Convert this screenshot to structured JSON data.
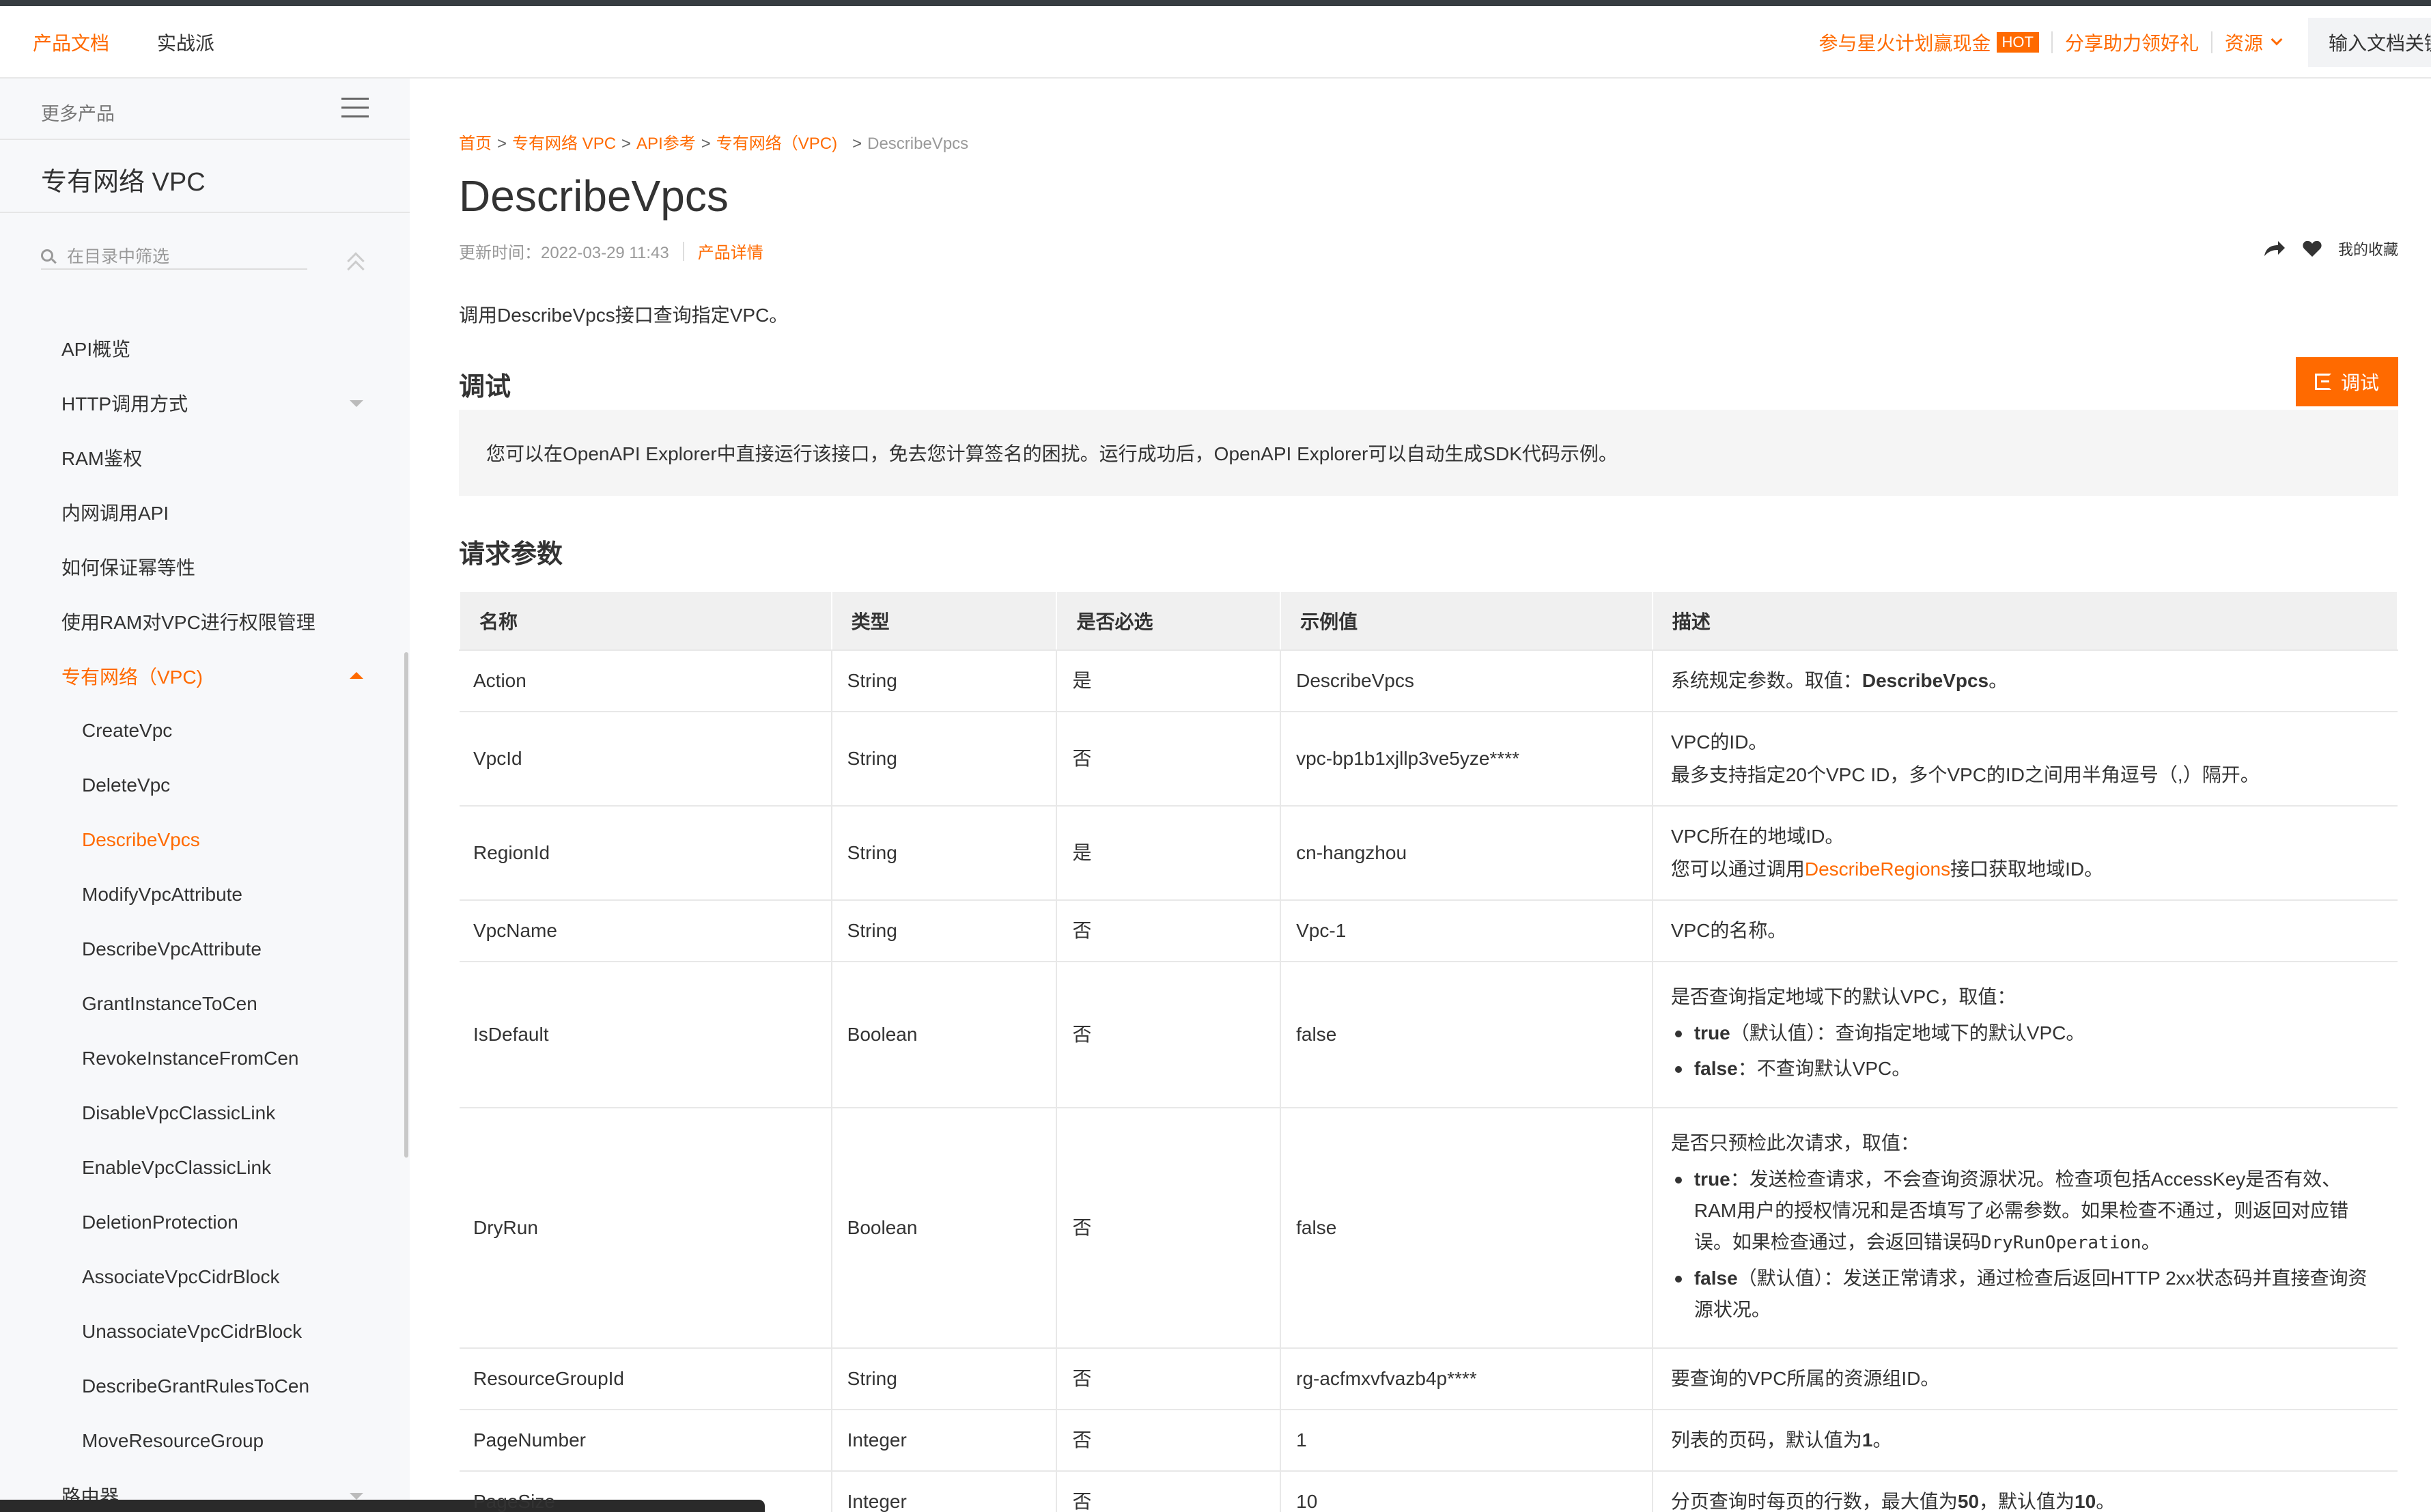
{
  "header": {
    "tabs": [
      "产品文档",
      "实战派"
    ],
    "promo": "参与星火计划赢现金",
    "hot_badge": "HOT",
    "share_gift": "分享助力领好礼",
    "resources": "资源",
    "search_placeholder": "输入文档关键"
  },
  "sidebar": {
    "more_products": "更多产品",
    "product_name": "专有网络 VPC",
    "filter_placeholder": "在目录中筛选",
    "items": [
      {
        "label": "API概览"
      },
      {
        "label": "HTTP调用方式"
      },
      {
        "label": "RAM鉴权"
      },
      {
        "label": "内网调用API"
      },
      {
        "label": "如何保证幂等性"
      },
      {
        "label": "使用RAM对VPC进行权限管理"
      },
      {
        "label": "专有网络（VPC)"
      },
      {
        "label": "CreateVpc"
      },
      {
        "label": "DeleteVpc"
      },
      {
        "label": "DescribeVpcs"
      },
      {
        "label": "ModifyVpcAttribute"
      },
      {
        "label": "DescribeVpcAttribute"
      },
      {
        "label": "GrantInstanceToCen"
      },
      {
        "label": "RevokeInstanceFromCen"
      },
      {
        "label": "DisableVpcClassicLink"
      },
      {
        "label": "EnableVpcClassicLink"
      },
      {
        "label": "DeletionProtection"
      },
      {
        "label": "AssociateVpcCidrBlock"
      },
      {
        "label": "UnassociateVpcCidrBlock"
      },
      {
        "label": "DescribeGrantRulesToCen"
      },
      {
        "label": "MoveResourceGroup"
      },
      {
        "label": "路由器"
      }
    ]
  },
  "breadcrumb": {
    "items": [
      "首页",
      "专有网络 VPC",
      "API参考",
      "专有网络（VPC)"
    ],
    "current": "DescribeVpcs"
  },
  "page": {
    "title": "DescribeVpcs",
    "updated": "更新时间：2022-03-29 11:43",
    "product_detail": "产品详情",
    "favorite": "我的收藏",
    "intro": "调用DescribeVpcs接口查询指定VPC。",
    "debug_heading": "调试",
    "debug_button": "调试",
    "debug_tip": "您可以在OpenAPI Explorer中直接运行该接口，免去您计算签名的困扰。运行成功后，OpenAPI Explorer可以自动生成SDK代码示例。",
    "params_heading": "请求参数"
  },
  "table": {
    "headers": [
      "名称",
      "类型",
      "是否必选",
      "示例值",
      "描述"
    ],
    "rows": [
      {
        "name": "Action",
        "type": "String",
        "req": "是",
        "example": "DescribeVpcs",
        "d1": "系统规定参数。取值：",
        "d2": "DescribeVpcs",
        "d3": "。"
      },
      {
        "name": "VpcId",
        "type": "String",
        "req": "否",
        "example": "vpc-bp1b1xjllp3ve5yze****",
        "d1": "VPC的ID。",
        "d2": "最多支持指定20个VPC ID，多个VPC的ID之间用半角逗号（,）隔开。"
      },
      {
        "name": "RegionId",
        "type": "String",
        "req": "是",
        "example": "cn-hangzhou",
        "d1": "VPC所在的地域ID。",
        "d2": "您可以通过调用",
        "link": "DescribeRegions",
        "d3": "接口获取地域ID。"
      },
      {
        "name": "VpcName",
        "type": "String",
        "req": "否",
        "example": "Vpc-1",
        "d1": "VPC的名称。"
      },
      {
        "name": "IsDefault",
        "type": "Boolean",
        "req": "否",
        "example": "false",
        "d1": "是否查询指定地域下的默认VPC，取值：",
        "b1k": "true",
        "b1t": "（默认值）：查询指定地域下的默认VPC。",
        "b2k": "false",
        "b2t": "：不查询默认VPC。"
      },
      {
        "name": "DryRun",
        "type": "Boolean",
        "req": "否",
        "example": "false",
        "d1": "是否只预检此次请求，取值：",
        "b1k": "true",
        "b1t": "：发送检查请求，不会查询资源状况。检查项包括AccessKey是否有效、RAM用户的授权情况和是否填写了必需参数。如果检查不通过，则返回对应错误。如果检查通过，会返回错误码",
        "b1c": "DryRunOperation",
        "b1e": "。",
        "b2k": "false",
        "b2t": "（默认值）：发送正常请求，通过检查后返回HTTP 2xx状态码并直接查询资源状况。"
      },
      {
        "name": "ResourceGroupId",
        "type": "String",
        "req": "否",
        "example": "rg-acfmxvfvazb4p****",
        "d1": "要查询的VPC所属的资源组ID。"
      },
      {
        "name": "PageNumber",
        "type": "Integer",
        "req": "否",
        "example": "1",
        "d1": "列表的页码，默认值为",
        "d2": "1",
        "d3": "。"
      },
      {
        "name": "PageSize",
        "type": "Integer",
        "req": "否",
        "example": "10",
        "d1": "分页查询时每页的行数，最大值为",
        "d2": "50",
        "d3": "，默认值为",
        "d4": "10",
        "d5": "。"
      }
    ]
  },
  "colors": {
    "accent": "#ff6a00",
    "sidebar_bg": "#f7f8fa",
    "table_header_bg": "#f0f0f0"
  }
}
